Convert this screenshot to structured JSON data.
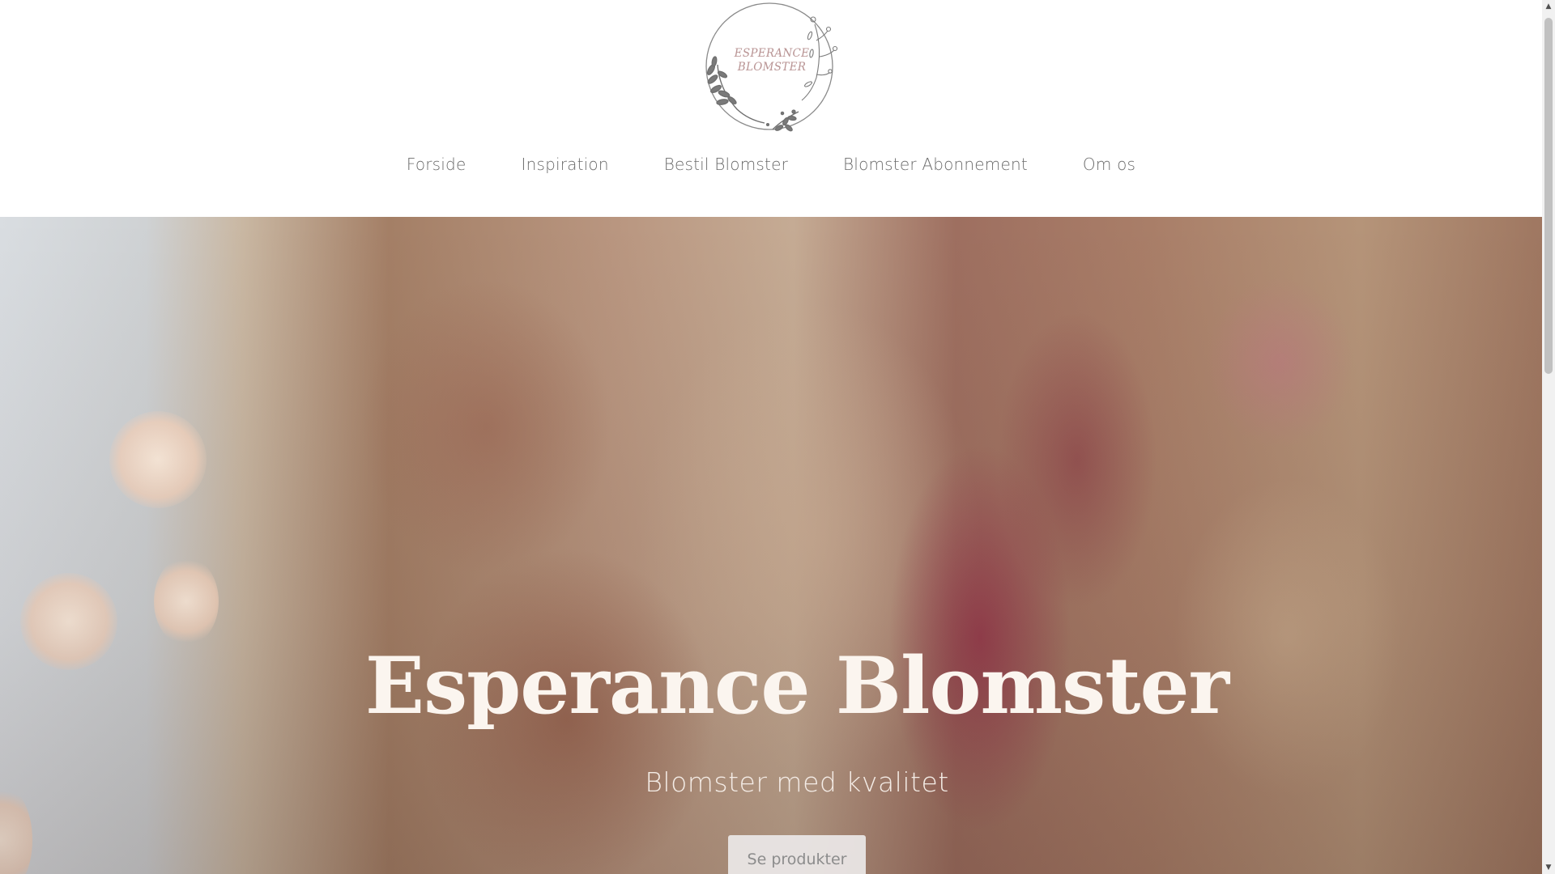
{
  "logo": {
    "line1": "ESPERANCE",
    "line2": "BLOMSTER",
    "icon": "floral-wreath-logo"
  },
  "nav": {
    "items": [
      {
        "label": "Forside"
      },
      {
        "label": "Inspiration"
      },
      {
        "label": "Bestil Blomster"
      },
      {
        "label": "Blomster Abonnement"
      },
      {
        "label": "Om os"
      }
    ]
  },
  "hero": {
    "title": "Esperance Blomster",
    "subtitle": "Blomster med kvalitet",
    "button_label": "Se produkter"
  },
  "scrollbar": {
    "up_icon": "scroll-up-arrow",
    "down_icon": "scroll-down-arrow"
  },
  "colors": {
    "nav_text": "#6b6b6b",
    "logo_text": "#b89393",
    "hero_title": "#fbf5ef",
    "button_bg": "#ebe8e8",
    "button_text": "#8c8c8c"
  }
}
